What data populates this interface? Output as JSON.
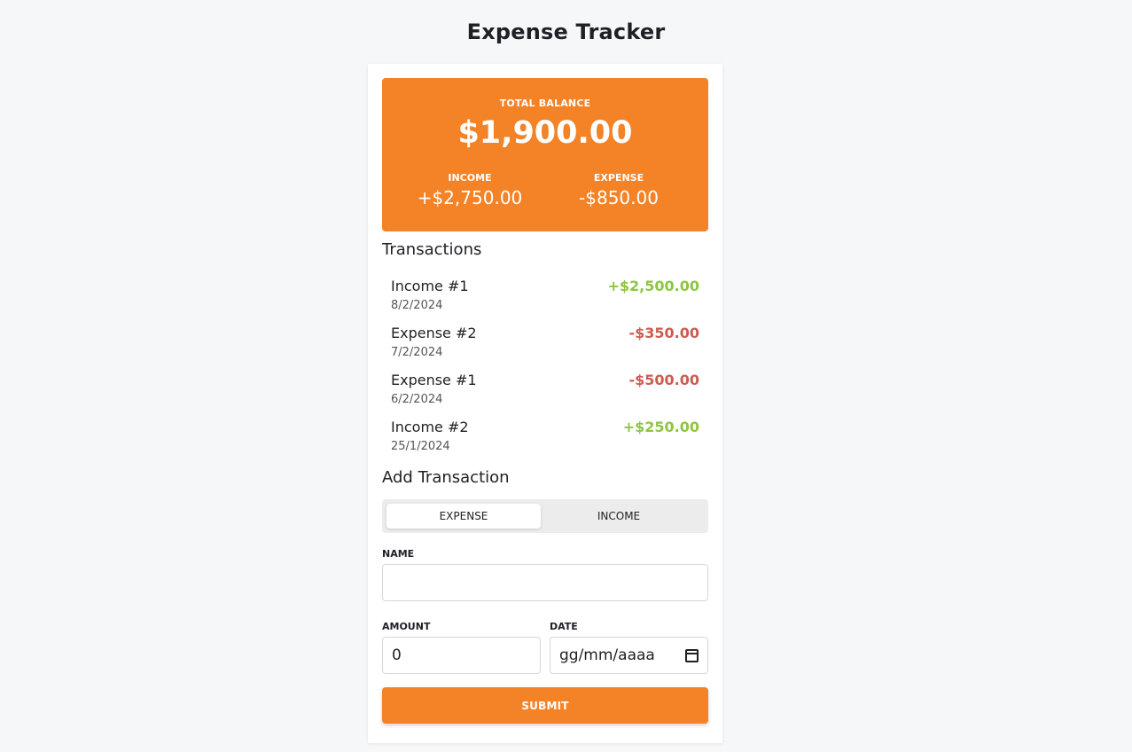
{
  "header": {
    "title": "Expense Tracker"
  },
  "balance": {
    "label": "TOTAL BALANCE",
    "amount": "$1,900.00",
    "income_label": "INCOME",
    "income_value": "+$2,750.00",
    "expense_label": "EXPENSE",
    "expense_value": "-$850.00"
  },
  "transactions": {
    "title": "Transactions",
    "items": [
      {
        "name": "Income #1",
        "date": "8/2/2024",
        "amount": "+$2,500.00",
        "type": "income"
      },
      {
        "name": "Expense #2",
        "date": "7/2/2024",
        "amount": "-$350.00",
        "type": "expense"
      },
      {
        "name": "Expense #1",
        "date": "6/2/2024",
        "amount": "-$500.00",
        "type": "expense"
      },
      {
        "name": "Income #2",
        "date": "25/1/2024",
        "amount": "+$250.00",
        "type": "income"
      }
    ]
  },
  "form": {
    "title": "Add Transaction",
    "toggle": {
      "expense": "EXPENSE",
      "income": "INCOME",
      "selected": "EXPENSE"
    },
    "name_label": "NAME",
    "name_value": "",
    "amount_label": "AMOUNT",
    "amount_value": "0",
    "date_label": "DATE",
    "date_placeholder": "gg/mm/aaaa",
    "submit_label": "SUBMIT"
  },
  "colors": {
    "accent": "#f48226",
    "income": "#8ec63f",
    "expense": "#cd5c50",
    "background": "#f6f7f9"
  }
}
